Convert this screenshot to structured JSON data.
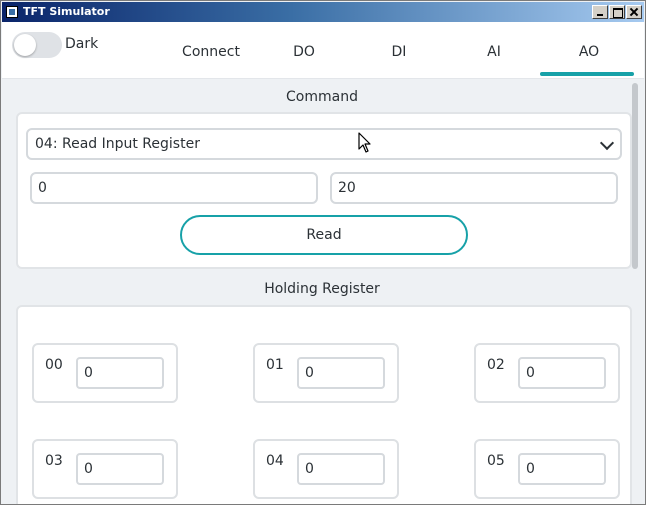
{
  "window": {
    "title": "TFT Simulator"
  },
  "topbar": {
    "toggle_label": "Dark",
    "toggle_on": false,
    "tabs": [
      {
        "label": "Connect",
        "active": false
      },
      {
        "label": "DO",
        "active": false
      },
      {
        "label": "DI",
        "active": false
      },
      {
        "label": "AI",
        "active": false
      },
      {
        "label": "AO",
        "active": true
      }
    ]
  },
  "command": {
    "title": "Command",
    "function_selected": "04: Read Input Register",
    "start_address": "0",
    "count": "20",
    "read_label": "Read"
  },
  "holding": {
    "title": "Holding Register",
    "registers": [
      {
        "label": "00",
        "value": "0"
      },
      {
        "label": "01",
        "value": "0"
      },
      {
        "label": "02",
        "value": "0"
      },
      {
        "label": "03",
        "value": "0"
      },
      {
        "label": "04",
        "value": "0"
      },
      {
        "label": "05",
        "value": "0"
      }
    ]
  },
  "colors": {
    "accent": "#17a1a8",
    "background": "#eef1f4",
    "card": "#ffffff",
    "text": "#2b3136"
  },
  "icons": [
    "app-icon",
    "minimize-icon",
    "maximize-icon",
    "close-icon",
    "chevron-down-icon",
    "mouse-cursor-icon"
  ]
}
